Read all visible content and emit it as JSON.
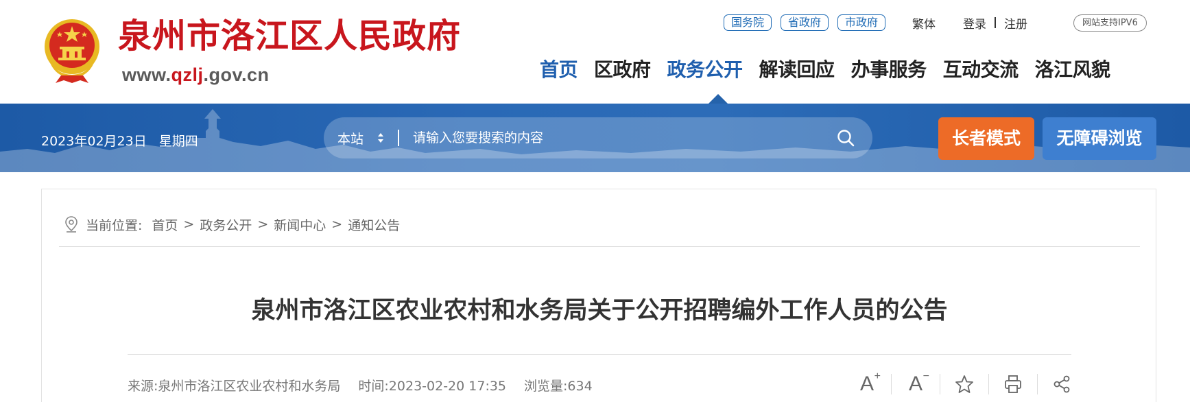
{
  "header": {
    "site_name": "泉州市洛江区人民政府",
    "url_prefix": "www.",
    "url_highlight": "qzlj",
    "url_suffix": ".gov.cn",
    "emblem_icon": "national-emblem-icon",
    "top_links": {
      "guowuyuan": "国务院",
      "shengzhengfu": "省政府",
      "shizhengfu": "市政府",
      "traditional": "繁体",
      "login": "登录",
      "register": "注册",
      "ipv6": "网站支持IPV6"
    },
    "nav": [
      "首页",
      "区政府",
      "政务公开",
      "解读回应",
      "办事服务",
      "互动交流",
      "洛江风貌"
    ],
    "active_nav": "政务公开"
  },
  "banner": {
    "date": "2023年02月23日",
    "weekday": "星期四",
    "search": {
      "scope": "本站",
      "placeholder": "请输入您要搜索的内容",
      "value": ""
    },
    "elder_mode": "长者模式",
    "accessible": "无障碍浏览"
  },
  "breadcrumb": {
    "label": "当前位置:",
    "items": [
      "首页",
      "政务公开",
      "新闻中心",
      "通知公告"
    ],
    "separator": ">"
  },
  "article": {
    "title": "泉州市洛江区农业农村和水务局关于公开招聘编外工作人员的公告",
    "source": "来源:泉州市洛江区农业农村和水务局",
    "time": "时间:2023-02-20 17:35",
    "views": "浏览量:634"
  },
  "tools": {
    "font_increase": "A",
    "font_decrease": "A",
    "icons": [
      "font-increase-icon",
      "font-decrease-icon",
      "star-icon",
      "print-icon",
      "share-icon"
    ]
  },
  "colors": {
    "brand_red": "#c8161d",
    "brand_blue": "#1f5fae",
    "banner_blue": "#2a69b6",
    "elder_orange": "#ed6b27",
    "access_blue": "#3e7fd0"
  }
}
